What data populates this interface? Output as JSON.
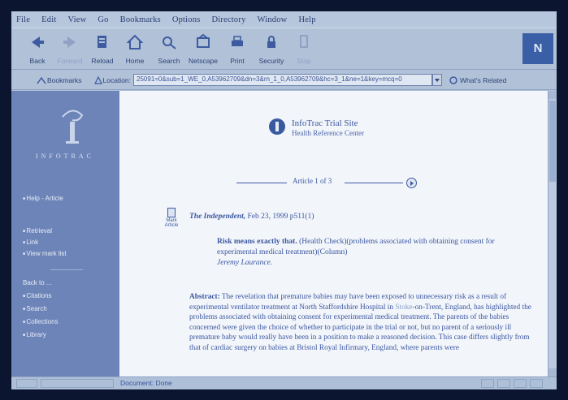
{
  "menu": [
    "File",
    "Edit",
    "View",
    "Go",
    "Bookmarks",
    "Options",
    "Directory",
    "Window",
    "Help"
  ],
  "toolbar": {
    "back": "Back",
    "forward": "Forward",
    "reload": "Reload",
    "home": "Home",
    "search": "Search",
    "netscape": "Netscape",
    "print": "Print",
    "security": "Security",
    "stop": "Stop",
    "brand": "N"
  },
  "locationbar": {
    "bookmarks": "Bookmarks",
    "location_label": "Location:",
    "url": "25091=0&sub=1_WE_0,A53962709&dn=3&rn_1_0,A53962709&hc=3_1&ne=1&key=mcq=0",
    "whats_related": "What's Related"
  },
  "sidebar": {
    "logo_text": "INFOTRAC",
    "help": "Help - Article",
    "retrieval": "Retrieval",
    "link": "Link",
    "view_mark": "View mark list",
    "back_to": "Back to ...",
    "citations": "Citations",
    "search": "Search",
    "collections": "Collections",
    "library": "Library"
  },
  "article": {
    "site_title": "InfoTrac Trial Site",
    "site_subtitle": "Health Reference Center",
    "counter": "Article 1 of 3",
    "mark_label": "Mark Article",
    "publication": "The Independent,",
    "date": " Feb 23, 1999 p511(1)",
    "headline_bold": "Risk means exactly that.",
    "headline_rest": " (Health Check)(problems associated with obtaining consent for experimental medical treatment)(Column)",
    "author": "Jeremy Laurance.",
    "abstract_label": "Abstract:",
    "abstract_a": " The revelation that premature babies may have been exposed to unnecessary risk as a result of experimental ventilator treatment at North Staffordshire Hospital in ",
    "abstract_link": "Stoke",
    "abstract_b": "-on-Trent, England, has highlighted the problems associated with obtaining consent for experimental medical treatment. The parents of the babies concerned were given the choice of whether to participate in the trial or not, but no parent of a seriously ill premature baby would really have been in a position to make a reasoned decision. This case differs slightly from that of cardiac surgery on babies at Bristol Royal Infirmary, England, where parents were"
  },
  "status": {
    "text": "Document: Done"
  },
  "colors": {
    "sidebar": "#6d84b8",
    "content_bg": "#f2f5fa",
    "text_blue": "#3a56a0"
  }
}
